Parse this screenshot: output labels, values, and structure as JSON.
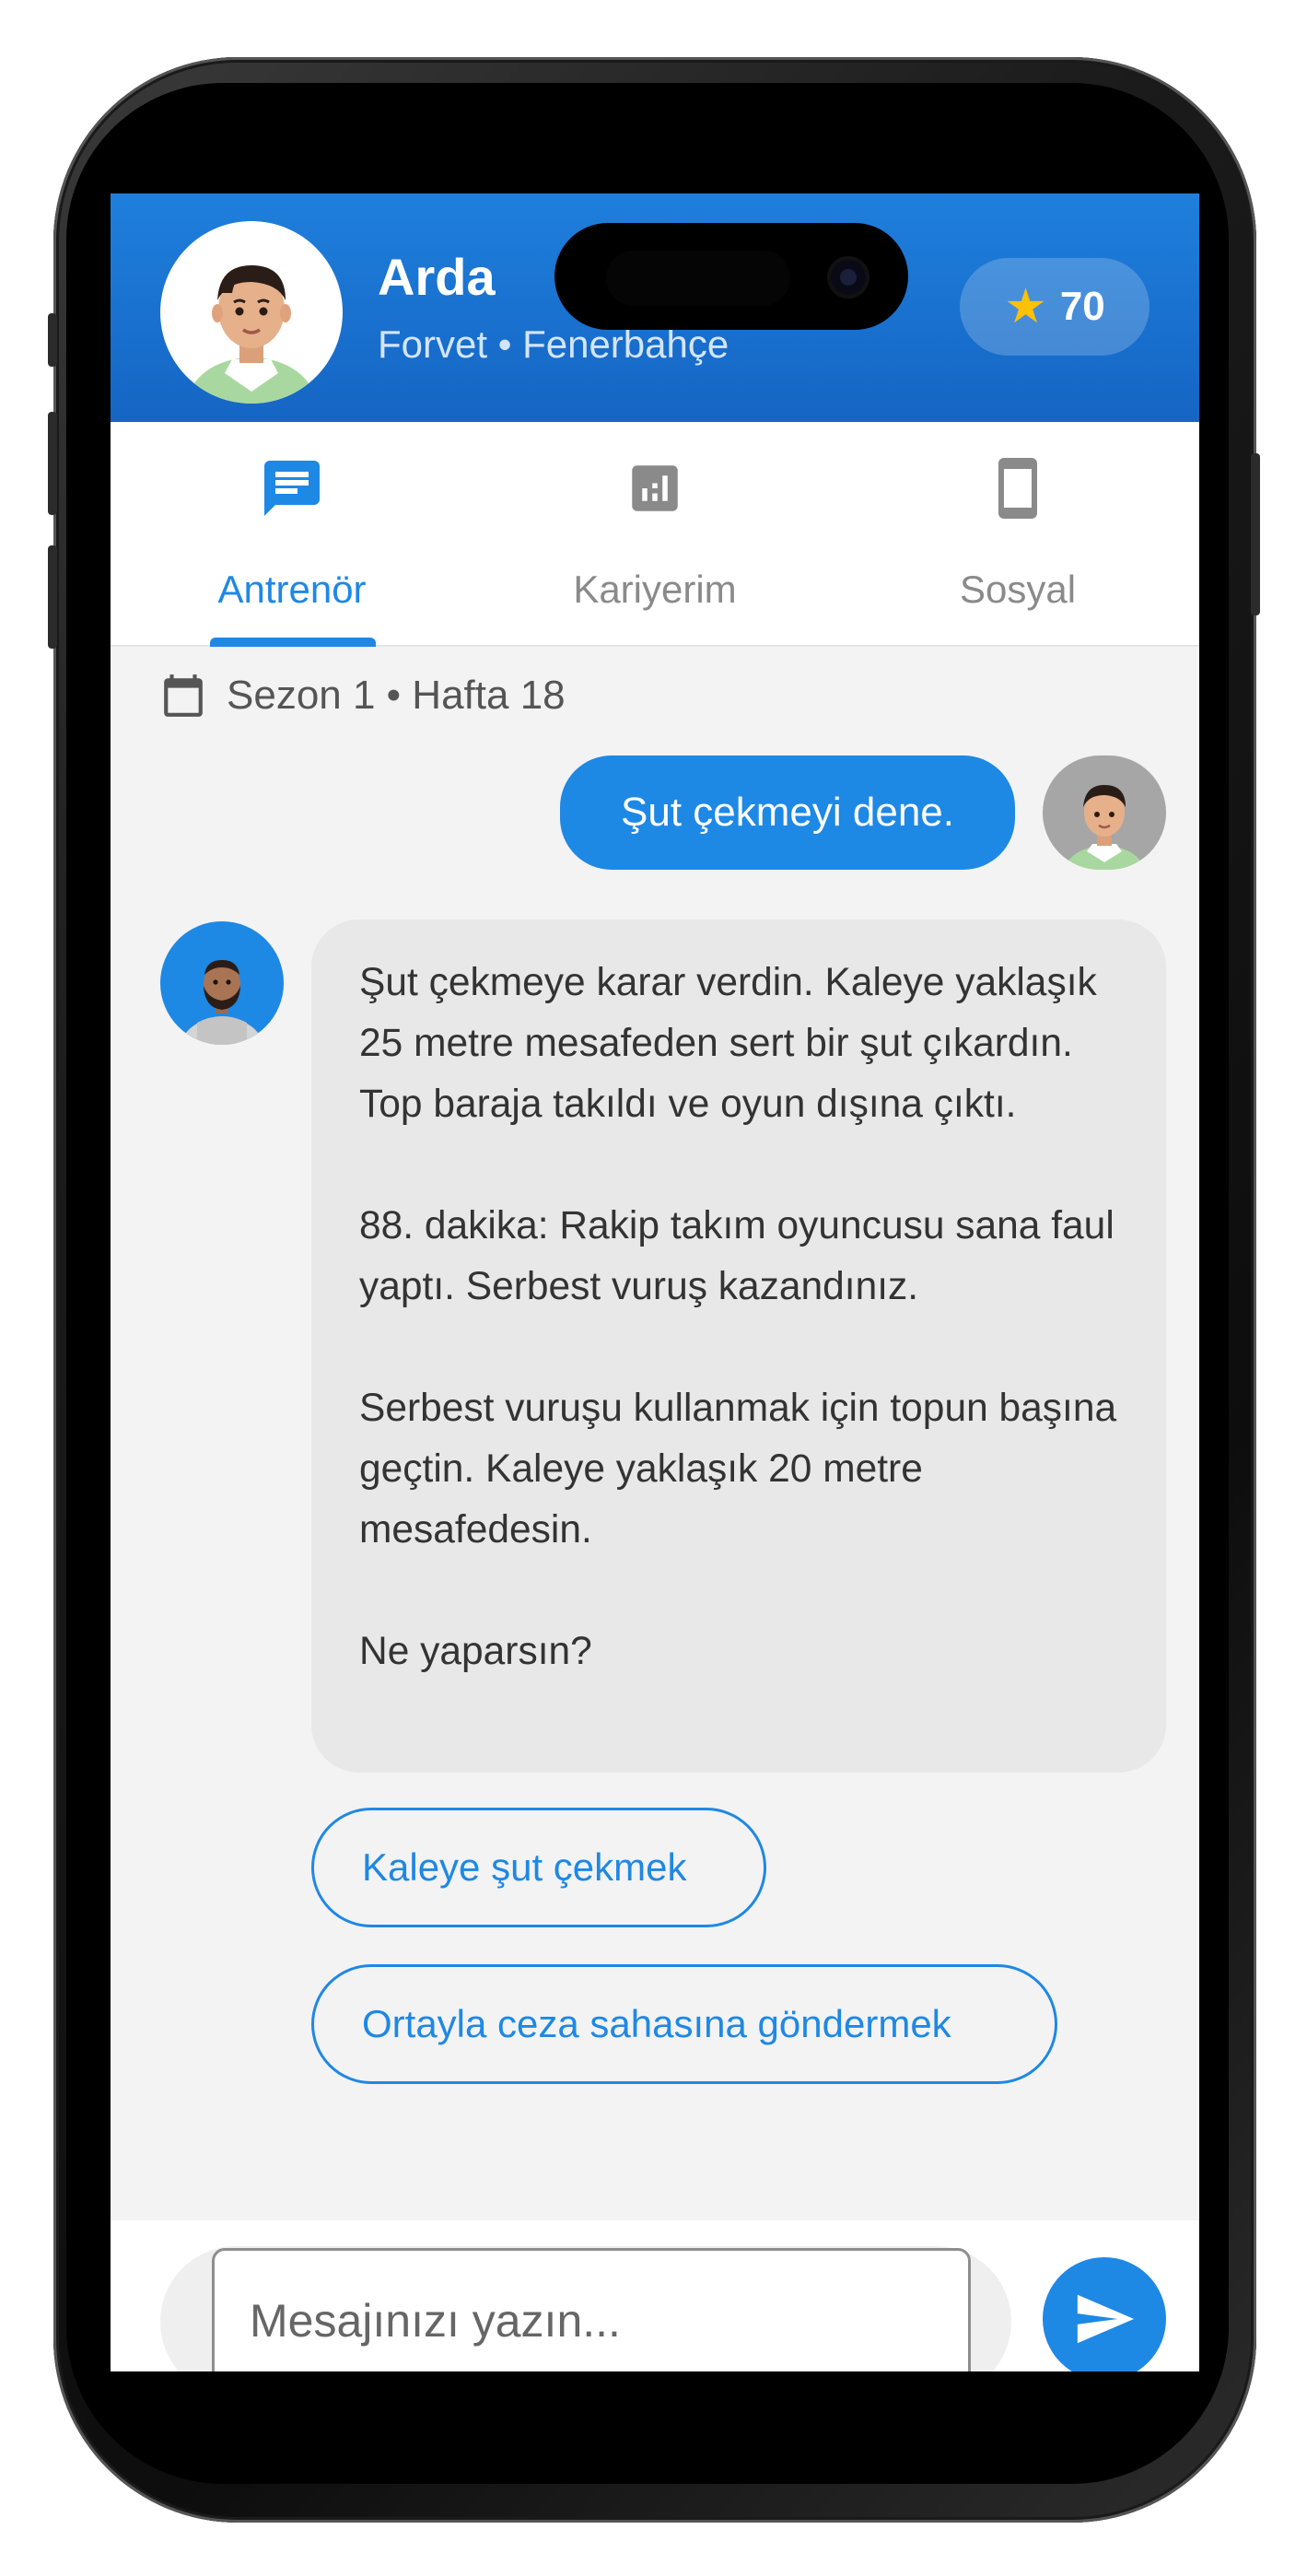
{
  "header": {
    "name": "Arda",
    "subtitle": "Forvet • Fenerbahçe",
    "score": "70",
    "score_icon": "star-icon",
    "accent": "#1e88e5"
  },
  "tabs": [
    {
      "label": "Antrenör",
      "icon": "chat-icon",
      "active": true
    },
    {
      "label": "Kariyerim",
      "icon": "stats-icon",
      "active": false
    },
    {
      "label": "Sosyal",
      "icon": "phone-icon",
      "active": false
    }
  ],
  "chat": {
    "week_label": "Sezon 1 • Hafta 18",
    "user_message": "Şut çekmeyi dene.",
    "coach_paragraphs": [
      "Şut çekmeye karar verdin. Kaleye yaklaşık 25 metre mesafeden sert bir şut çıkardın. Top baraja takıldı ve oyun dışına çıktı.",
      "88. dakika: Rakip takım oyuncusu sana faul yaptı. Serbest vuruş kazandınız.",
      "Serbest vuruşu kullanmak için topun başına geçtin. Kaleye yaklaşık 20 metre mesafedesin.",
      "Ne yaparsın?"
    ],
    "options": [
      "Kaleye şut çekmek",
      "Ortayla ceza sahasına göndermek"
    ]
  },
  "composer": {
    "placeholder": "Mesajınızı yazın...",
    "send_icon": "send-icon"
  }
}
